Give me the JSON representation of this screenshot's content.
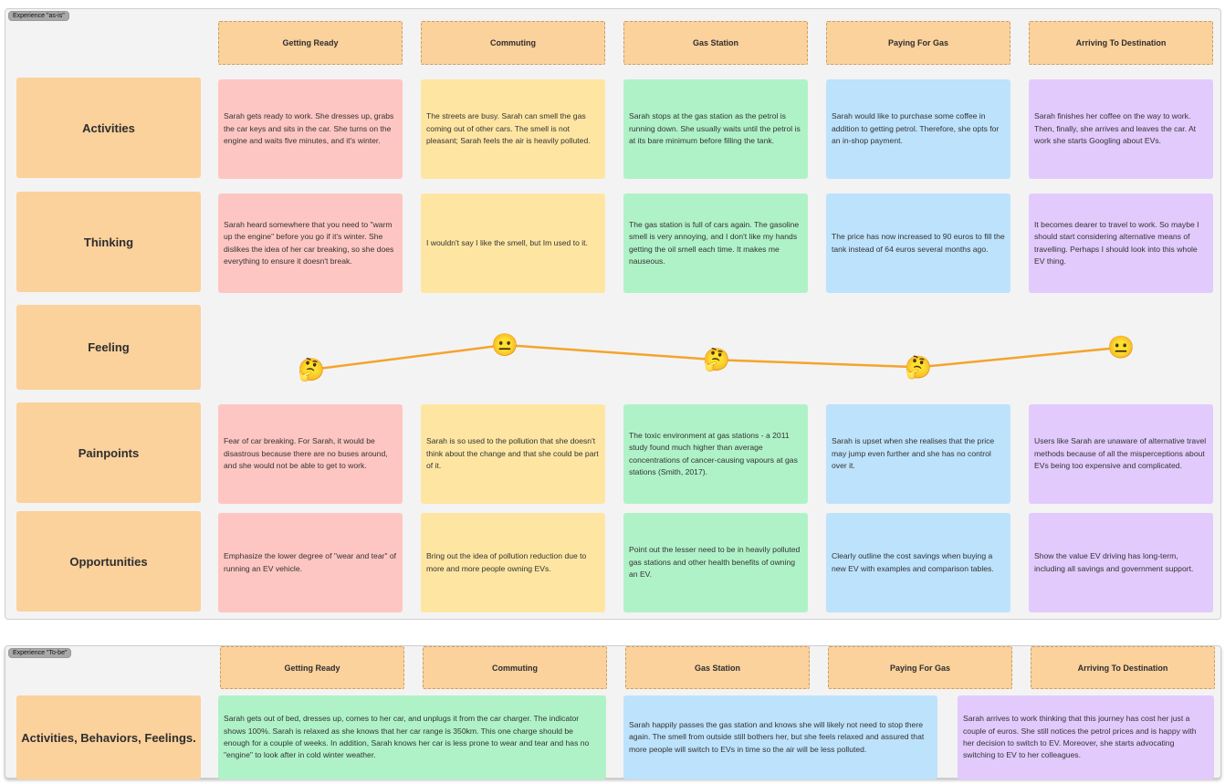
{
  "as_is": {
    "tag": "Experience \"as-is\"",
    "phases": [
      "Getting Ready",
      "Commuting",
      "Gas Station",
      "Paying For Gas",
      "Arriving To Destination"
    ],
    "rows": [
      {
        "label": "Activities",
        "cells": [
          "Sarah gets ready to work. She dresses up, grabs the car keys and sits in the car. She turns on the engine and waits five minutes, and it's winter.",
          "The streets are busy. Sarah can smell the gas coming out of other cars. The smell is not pleasant; Sarah feels the air is heavily polluted.",
          "Sarah stops at the gas station as the petrol is running down. She usually waits until the petrol is at its bare minimum before filling the tank.",
          "Sarah would like to purchase some coffee in addition to getting petrol. Therefore, she opts for an in-shop payment.",
          "Sarah finishes her coffee on the way to work. Then, finally, she arrives and leaves the car. At work she starts Googling about EVs."
        ]
      },
      {
        "label": "Thinking",
        "cells": [
          "Sarah heard somewhere that you need to \"warm up the engine\" before you go if it's winter. She dislikes the idea of her car breaking, so she does everything to ensure it doesn't break.",
          "I wouldn't say I like the smell, but Im used to it.",
          "The gas station is full of cars again. The gasoline smell is very annoying, and I don't like my hands getting the oil smell each time. It makes me nauseous.",
          "The price has now increased to 90 euros to fill the tank instead of 64 euros several months ago.",
          "It becomes dearer to travel to work. So maybe I should start considering alternative means of travelling. Perhaps I should look into this whole EV thing."
        ]
      },
      {
        "label": "Feeling",
        "cells": []
      },
      {
        "label": "Painpoints",
        "cells": [
          "Fear of car breaking. For Sarah, it would be disastrous because there are no buses around, and she would not be able to get to work.",
          "Sarah is so used to the pollution that she doesn't think about the change and that she could be part of it.",
          "The toxic environment at gas stations - a 2011 study found much higher than average concentrations of cancer-causing vapours at gas stations (Smith, 2017).",
          "Sarah is upset when she realises that the price may jump even further and she has no control over it.",
          "Users like Sarah are unaware of alternative travel methods because of all the misperceptions about EVs being too expensive and complicated."
        ]
      },
      {
        "label": "Opportunities",
        "cells": [
          "Emphasize the lower degree of \"wear and tear\" of running an EV vehicle.",
          "Bring out the idea of pollution reduction due to more and more people owning EVs.",
          "Point out the lesser need to be in heavily polluted gas stations and other health benefits of owning an EV.",
          "Clearly outline the cost savings when buying a new EV with examples and comparison tables.",
          "Show the value EV driving has long-term, including all savings and government support."
        ]
      }
    ],
    "feelings": [
      {
        "emoji": "🤔",
        "name": "thinking-face",
        "level": 0
      },
      {
        "emoji": "😐",
        "name": "neutral-face",
        "level": 1
      },
      {
        "emoji": "🤔",
        "name": "thinking-face",
        "level": 0.4
      },
      {
        "emoji": "🤔",
        "name": "thinking-face",
        "level": 0.1
      },
      {
        "emoji": "😐",
        "name": "neutral-face",
        "level": 0.9
      }
    ],
    "line_color": "#f5a32c"
  },
  "to_be": {
    "tag": "Experience \"To-be\"",
    "phases": [
      "Getting Ready",
      "Commuting",
      "Gas Station",
      "Paying For Gas",
      "Arriving To Destination"
    ],
    "row_label": "Activities, Behaviors, Feelings.",
    "cells": [
      "Sarah gets out of bed, dresses up, comes to her car, and unplugs it from the car charger. The indicator shows 100%. Sarah is relaxed as she knows that her car range is 350km. This one charge should be enough for a couple of weeks. In addition, Sarah knows her car is less prone to wear and tear and has no \"engine\" to look after in cold winter weather.",
      "Sarah happily passes the gas station and knows she will likely not need to stop there again. The smell from outside still bothers her, but she feels relaxed and assured that more people will switch to EVs in time so the air will be less polluted.",
      "Sarah arrives to work thinking that this journey has cost her just a couple of euros. She still notices the petrol prices and is happy with her decision to switch to EV. Moreover, she starts advocating switching to EV to her colleagues."
    ]
  }
}
